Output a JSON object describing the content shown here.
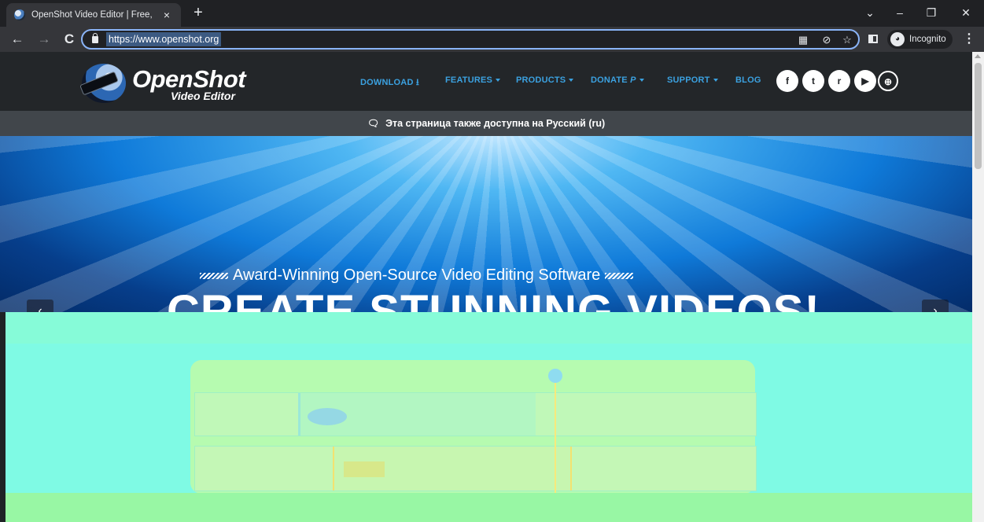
{
  "browser": {
    "tab_title": "OpenShot Video Editor | Free, Op",
    "new_tab": "+",
    "close_tab": "×",
    "url": "https://www.openshot.org",
    "incognito_label": "Incognito",
    "window_controls": {
      "dropdown": "⌄",
      "minimize": "–",
      "restore": "❐",
      "close": "✕"
    },
    "nav": {
      "back": "←",
      "forward": "→",
      "reload": "C"
    },
    "omnibox_icons": {
      "qr": "▦",
      "eye_off": "⊘",
      "star": "☆"
    },
    "menu": "⋮"
  },
  "site": {
    "logo": {
      "title": "OpenShot",
      "subtitle": "Video Editor"
    },
    "nav_links": [
      "DOWNLOAD",
      "FEATURES",
      "PRODUCTS",
      "DONATE",
      "SUPPORT",
      "BLOG"
    ],
    "social_icons": [
      "f",
      "t",
      "r",
      "▶",
      "⊕"
    ],
    "language_notice": "Эта страница также доступна на Русский (ru)",
    "hero": {
      "tagline": "Award-Winning Open-Source Video Editing Software",
      "headline": "CREATE STUNNING VIDEOS!",
      "prev": "‹",
      "next": "›"
    }
  },
  "colors": {
    "accent_link": "#3ba1e0",
    "nav_bg": "#232629",
    "lang_bar_bg": "#41464b",
    "omnibox_focus": "#8ab4f8"
  }
}
